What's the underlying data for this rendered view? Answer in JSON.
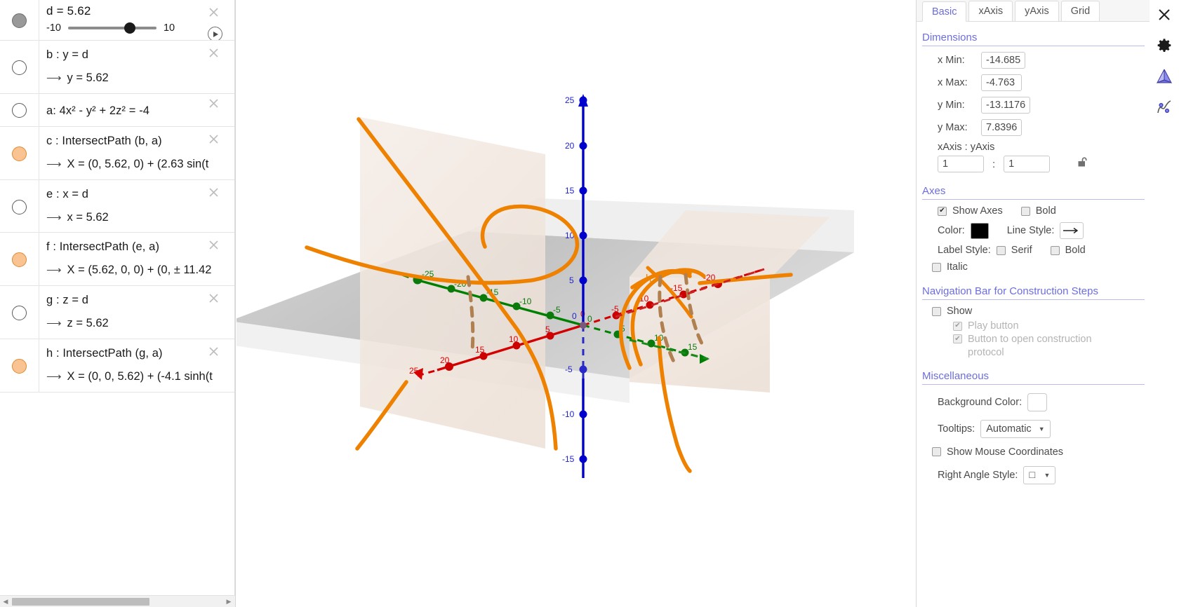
{
  "algebra": {
    "rows": [
      {
        "kind": "slider",
        "marker": "filled-gray",
        "title": "d = 5.62",
        "min": "-10",
        "max": "10",
        "value": "5.62",
        "play_icon": "play-icon",
        "close_icon": "close-icon"
      },
      {
        "kind": "expr",
        "marker": "empty",
        "definition": "b : y = d",
        "output": "y = 5.62",
        "close_icon": "close-icon"
      },
      {
        "kind": "expr-single",
        "marker": "empty",
        "definition": "a: 4x² - y² + 2z² = -4",
        "output": "",
        "close_icon": "close-icon"
      },
      {
        "kind": "expr",
        "marker": "filled-orange",
        "definition": "c : IntersectPath (b, a)",
        "output": "X = (0, 5.62, 0) + (2.63 sin(t",
        "close_icon": "close-icon"
      },
      {
        "kind": "expr",
        "marker": "empty",
        "definition": "e : x = d",
        "output": "x = 5.62",
        "close_icon": "close-icon"
      },
      {
        "kind": "expr",
        "marker": "filled-orange",
        "definition": "f : IntersectPath (e, a)",
        "output": "X = (5.62, 0, 0) + (0, ± 11.42",
        "close_icon": "close-icon"
      },
      {
        "kind": "expr",
        "marker": "empty",
        "definition": "g : z = d",
        "output": "z = 5.62",
        "close_icon": "close-icon"
      },
      {
        "kind": "expr",
        "marker": "filled-orange",
        "definition": "h : IntersectPath (g, a)",
        "output": "X = (0, 0, 5.62) + (-4.1 sinh(t",
        "close_icon": "close-icon"
      }
    ],
    "scrollbar": {
      "left_arrow": "◀",
      "right_arrow": "▶"
    }
  },
  "settings": {
    "tabs": [
      {
        "label": "Basic",
        "active": true
      },
      {
        "label": "xAxis",
        "active": false
      },
      {
        "label": "yAxis",
        "active": false
      },
      {
        "label": "Grid",
        "active": false
      }
    ],
    "dimensions": {
      "heading": "Dimensions",
      "x_min_label": "x Min:",
      "x_min_value": "-14.685",
      "x_max_label": "x Max:",
      "x_max_value": "-4.763",
      "y_min_label": "y Min:",
      "y_min_value": "-13.1176",
      "y_max_label": "y Max:",
      "y_max_value": "7.8396",
      "ratio_label": "xAxis : yAxis",
      "ratio_x": "1",
      "ratio_colon": ":",
      "ratio_y": "1",
      "lock_icon": "unlocked-padlock-icon"
    },
    "axes": {
      "heading": "Axes",
      "show_axes_label": "Show Axes",
      "show_axes_checked": true,
      "bold_label": "Bold",
      "bold_checked": false,
      "color_label": "Color:",
      "color_value": "#000000",
      "line_style_label": "Line Style:",
      "line_style_icon": "arrow-line-icon",
      "label_style_label": "Label Style:",
      "serif_label": "Serif",
      "serif_checked": false,
      "label_bold_label": "Bold",
      "label_bold_checked": false,
      "italic_label": "Italic",
      "italic_checked": false
    },
    "navbar": {
      "heading": "Navigation Bar for Construction Steps",
      "show_label": "Show",
      "show_checked": false,
      "play_button_label": "Play button",
      "play_button_checked": true,
      "protocol_label": "Button to open construction protocol",
      "protocol_checked": true
    },
    "misc": {
      "heading": "Miscellaneous",
      "background_color_label": "Background Color:",
      "background_color_value": "#ffffff",
      "tooltips_label": "Tooltips:",
      "tooltips_value": "Automatic",
      "show_mouse_coords_label": "Show Mouse Coordinates",
      "show_mouse_coords_checked": false,
      "right_angle_label": "Right Angle Style:",
      "right_angle_value": "□"
    }
  },
  "right_toolbar": {
    "icons": [
      {
        "name": "close-icon",
        "glyph": "✕"
      },
      {
        "name": "gear-icon",
        "glyph": "gear"
      },
      {
        "name": "view-3d-icon",
        "glyph": "pyramid"
      },
      {
        "name": "graphing-icon",
        "glyph": "curve"
      }
    ]
  },
  "graphics3d": {
    "colors": {
      "x_axis": "#d40000",
      "y_axis": "#008000",
      "z_axis": "#0000cc",
      "curve": "#ee8100",
      "plane_fill": "#f2e7e0",
      "floor_fill": "#c6c6c6",
      "label_h": "h"
    },
    "x_axis_labels": [
      "25",
      "20",
      "15",
      "10",
      "5",
      "0",
      "-5",
      "-10",
      "-15",
      "-20"
    ],
    "y_axis_labels": [
      "-25",
      "-20",
      "-15",
      "-10",
      "-5",
      "0",
      "5",
      "10",
      "15"
    ],
    "z_axis_labels": [
      "25",
      "20",
      "15",
      "10",
      "5",
      "0",
      "-5",
      "-10",
      "-15"
    ],
    "curve_label": "h",
    "origin_labels": [
      "0",
      "0",
      "0"
    ]
  }
}
